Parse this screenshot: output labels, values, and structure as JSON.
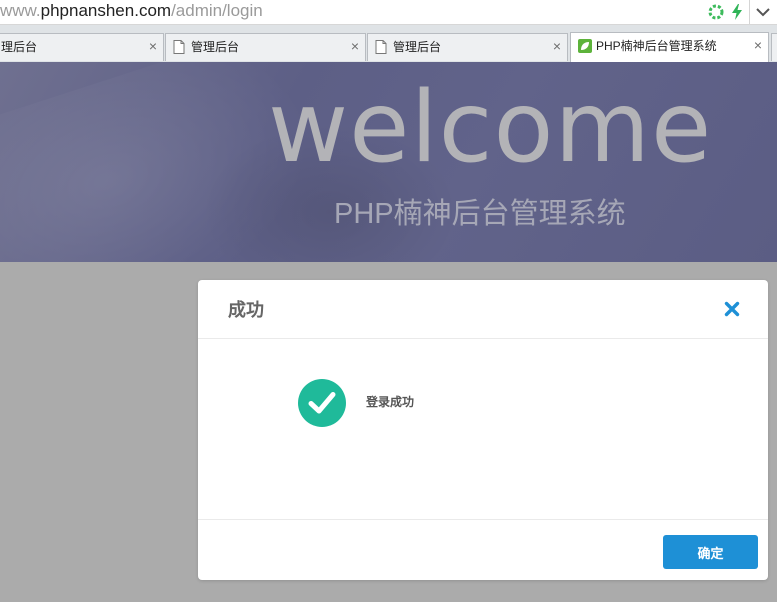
{
  "address_bar": {
    "url_prefix": "www.",
    "url_domain": "phpnanshen.com",
    "url_path": "/admin/login"
  },
  "tabs": [
    {
      "label": "理后台",
      "icon": "blank-page-icon",
      "active": false
    },
    {
      "label": "管理后台",
      "icon": "blank-page-icon",
      "active": false
    },
    {
      "label": "管理后台",
      "icon": "blank-page-icon",
      "active": false
    },
    {
      "label": "PHP楠神后台管理系统",
      "icon": "leaf-favicon-icon",
      "active": true
    }
  ],
  "tab_close_glyph": "×",
  "banner": {
    "headline": "welcome",
    "subtitle": "PHP楠神后台管理系统"
  },
  "dialog": {
    "title": "成功",
    "message": "登录成功",
    "confirm_label": "确定",
    "close_icon": "close-icon"
  },
  "colors": {
    "accent": "#1e90d6",
    "success": "#1fba9a",
    "banner": "#5f6188"
  }
}
